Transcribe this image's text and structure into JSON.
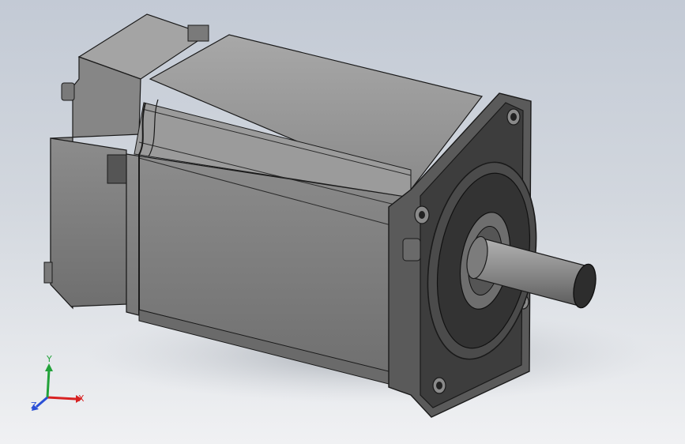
{
  "viewport": {
    "background_top": "#c3cad5",
    "background_bottom": "#f0f1f3"
  },
  "model": {
    "body_color": "#8f8f8f",
    "edge_color": "#1a1a1a",
    "face_color": "#3a3a3a",
    "shaft_color": "#8c8c8c"
  },
  "triad": {
    "x_label": "X",
    "y_label": "Y",
    "z_label": "Z",
    "x_color": "#d82222",
    "y_color": "#22a23a",
    "z_color": "#2a4fd6"
  }
}
